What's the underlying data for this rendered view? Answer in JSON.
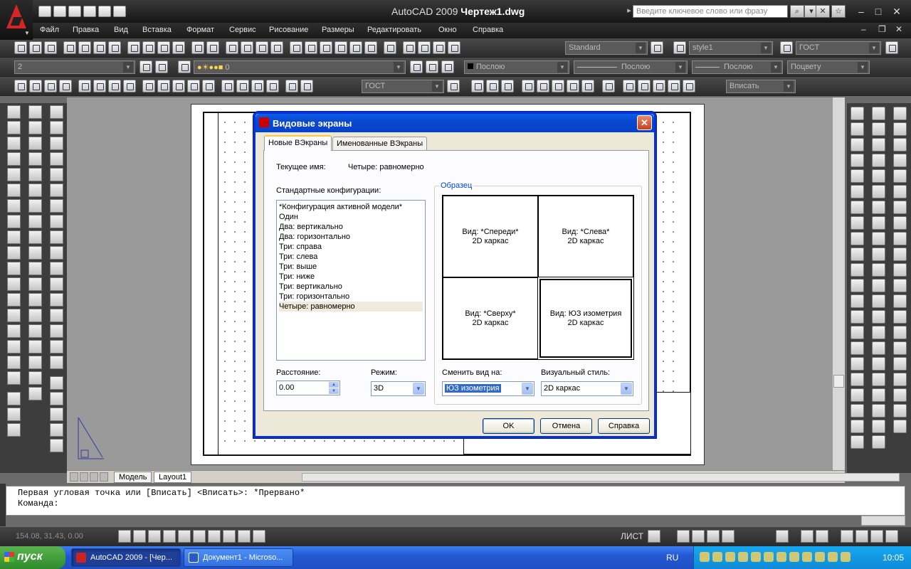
{
  "app": {
    "title_app": "AutoCAD 2009",
    "title_doc": "Чертеж1.dwg",
    "search_placeholder": "Введите ключевое слово или фразу"
  },
  "menu": [
    "Файл",
    "Правка",
    "Вид",
    "Вставка",
    "Формат",
    "Сервис",
    "Рисование",
    "Размеры",
    "Редактировать",
    "Окно",
    "Справка"
  ],
  "toolbars": {
    "text_style": "Standard",
    "dim_style": "style1",
    "table_style": "ГОСТ",
    "layer_state": "2",
    "layer_name": "0",
    "color": "Послою",
    "linetype": "Послою",
    "lineweight": "Послою",
    "plotstyle": "Поцвету",
    "dim_combo": "ГОСТ",
    "viewport_scale": "Вписать"
  },
  "layout_tabs": [
    "Модель",
    "Layout1"
  ],
  "command_line": [
    "Первая угловая точка или [Вписать] <Вписать>: *Прервано*",
    "Команда:"
  ],
  "status": {
    "coords": "154.08, 31.43, 0.00",
    "sheet_label": "ЛИСТ"
  },
  "taskbar": {
    "start_label": "пуск",
    "tasks": [
      "AutoCAD 2009 - [Чер...",
      "Документ1 - Microso..."
    ],
    "lang": "RU",
    "clock": "10:05"
  },
  "dialog": {
    "title": "Видовые экраны",
    "close_glyph": "✕",
    "tabs": [
      "Новые ВЭкраны",
      "Именованные ВЭкраны"
    ],
    "current_name_label": "Текущее имя:",
    "current_name_value": "Четыре: равномерно",
    "standard_configs_label": "Стандартные конфигурации:",
    "configs": [
      "*Конфигурация активной модели*",
      "Один",
      "Два: вертикально",
      "Два: горизонтально",
      "Три: справа",
      "Три: слева",
      "Три: выше",
      "Три: ниже",
      "Три: вертикально",
      "Три: горизонтально",
      "Четыре: равномерно"
    ],
    "selected_config_index": 10,
    "preview_label": "Образец",
    "viewports": [
      {
        "view": "Вид: *Спереди*",
        "style": "2D каркас"
      },
      {
        "view": "Вид: *Слева*",
        "style": "2D каркас"
      },
      {
        "view": "Вид: *Сверху*",
        "style": "2D каркас"
      },
      {
        "view": "Вид: ЮЗ изометрия",
        "style": "2D каркас"
      }
    ],
    "spacing_label": "Расстояние:",
    "spacing_value": "0.00",
    "mode_label": "Режим:",
    "mode_value": "3D",
    "change_view_label": "Сменить вид на:",
    "change_view_value": "ЮЗ изометрия",
    "visual_style_label": "Визуальный стиль:",
    "visual_style_value": "2D каркас",
    "ok": "OK",
    "cancel": "Отмена",
    "help": "Справка"
  },
  "colors": {
    "dialog_title_blue": "#0a48d1",
    "selection_blue": "#316ac5",
    "autocad_red": "#d42626"
  }
}
